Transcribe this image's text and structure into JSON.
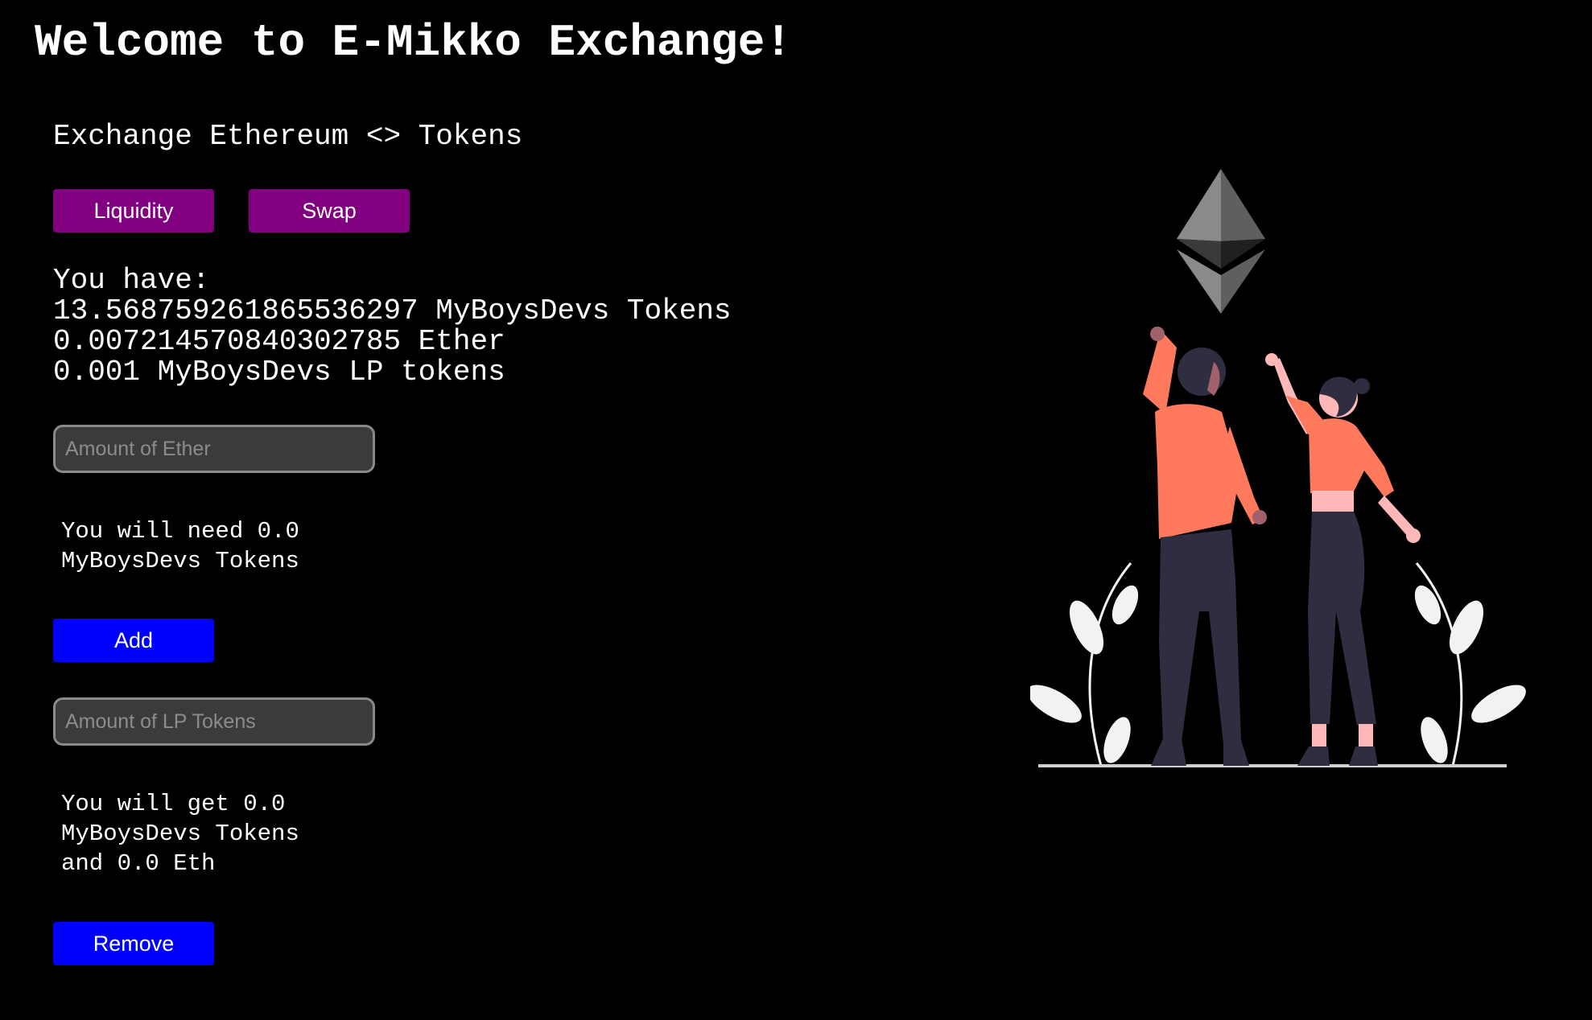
{
  "page": {
    "title": "Welcome to E-Mikko Exchange!",
    "subtitle": "Exchange Ethereum <> Tokens"
  },
  "tabs": {
    "liquidity_label": "Liquidity",
    "swap_label": "Swap"
  },
  "balances": {
    "heading": "You have:",
    "tokens": "13.568759261865536297 MyBoysDevs Tokens",
    "ether": "0.007214570840302785 Ether",
    "lp_tokens": "0.001 MyBoysDevs LP tokens"
  },
  "add_liquidity": {
    "input_value": "",
    "input_placeholder": "Amount of Ether",
    "note_line1": "You will need 0.0",
    "note_line2": "MyBoysDevs Tokens",
    "button_label": "Add"
  },
  "remove_liquidity": {
    "input_value": "",
    "input_placeholder": "Amount of LP Tokens",
    "note_line1": "You will get 0.0",
    "note_line2": "MyBoysDevs Tokens",
    "note_line3": "and 0.0 Eth",
    "button_label": "Remove"
  },
  "illustration": {
    "icon": "ethereum-logo-icon",
    "scene": "two-people-reaching-illustration"
  },
  "colors": {
    "background": "#000000",
    "tab_button": "#800080",
    "action_button": "#0000ff",
    "shirt": "#ff7a5c",
    "pants": "#2f2e41",
    "plants": "#f2f2f2"
  }
}
